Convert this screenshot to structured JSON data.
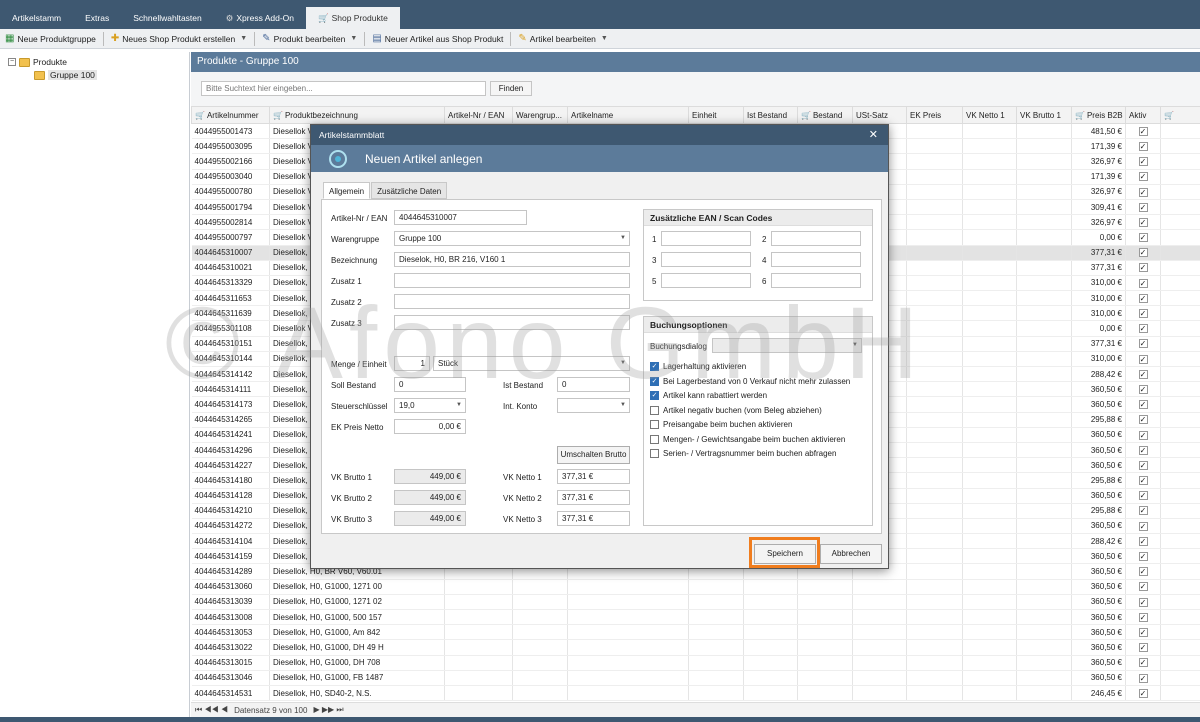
{
  "tabs": [
    "Artikelstamm",
    "Extras",
    "Schnellwahltasten",
    "Xpress Add-On",
    "Shop Produkte"
  ],
  "toolbar": {
    "b1": "Neue Produktgruppe",
    "b2": "Neues Shop Produkt erstellen",
    "b3": "Produkt bearbeiten",
    "b4": "Neuer Artikel aus Shop Produkt",
    "b5": "Artikel bearbeiten"
  },
  "tree": {
    "root": "Produkte",
    "child": "Gruppe 100",
    "expander": "−"
  },
  "panel": {
    "title": "Produkte - Gruppe 100",
    "search_placeholder": "Bitte Suchtext hier eingeben...",
    "find": "Finden"
  },
  "grid": {
    "columns": [
      "Artikelnummer",
      "Produktbezeichnung",
      "Artikel-Nr / EAN",
      "Warengrup...",
      "Artikelname",
      "Einheit",
      "Ist Bestand",
      "Bestand",
      "USt-Satz",
      "EK Preis",
      "VK Netto 1",
      "VK Brutto 1",
      "Preis B2B",
      "Aktiv"
    ],
    "rows": [
      [
        "4044955001473",
        "Diesellok V",
        "481,50 €"
      ],
      [
        "4044955003095",
        "Diesellok V",
        "171,39 €"
      ],
      [
        "4044955002166",
        "Diesellok V",
        "326,97 €"
      ],
      [
        "4044955003040",
        "Diesellok V",
        "171,39 €"
      ],
      [
        "4044955000780",
        "Diesellok V",
        "326,97 €"
      ],
      [
        "4044955001794",
        "Diesellok V",
        "309,41 €"
      ],
      [
        "4044955002814",
        "Diesellok V",
        "326,97 €"
      ],
      [
        "4044955000797",
        "Diesellok V",
        "0,00 €"
      ],
      [
        "4044645310007",
        "Diesellok, H",
        "377,31 €"
      ],
      [
        "4044645310021",
        "Diesellok, H",
        "377,31 €"
      ],
      [
        "4044645313329",
        "Diesellok, H",
        "310,00 €"
      ],
      [
        "4044645311653",
        "Diesellok, H",
        "310,00 €"
      ],
      [
        "4044645311639",
        "Diesellok, H",
        "310,00 €"
      ],
      [
        "4044955301108",
        "Diesellok V",
        "0,00 €"
      ],
      [
        "4044645310151",
        "Diesellok, H",
        "377,31 €"
      ],
      [
        "4044645310144",
        "Diesellok, H",
        "310,00 €"
      ],
      [
        "4044645314142",
        "Diesellok, H",
        "288,42 €"
      ],
      [
        "4044645314111",
        "Diesellok, H",
        "360,50 €"
      ],
      [
        "4044645314173",
        "Diesellok, H",
        "360,50 €"
      ],
      [
        "4044645314265",
        "Diesellok, H",
        "295,88 €"
      ],
      [
        "4044645314241",
        "Diesellok, H",
        "360,50 €"
      ],
      [
        "4044645314296",
        "Diesellok, H",
        "360,50 €"
      ],
      [
        "4044645314227",
        "Diesellok, H",
        "360,50 €"
      ],
      [
        "4044645314180",
        "Diesellok, H",
        "295,88 €"
      ],
      [
        "4044645314128",
        "Diesellok, H",
        "360,50 €"
      ],
      [
        "4044645314210",
        "Diesellok, H",
        "295,88 €"
      ],
      [
        "4044645314272",
        "Diesellok, H",
        "360,50 €"
      ],
      [
        "4044645314104",
        "Diesellok, H",
        "288,42 €"
      ],
      [
        "4044645314159",
        "Diesellok, H",
        "360,50 €"
      ],
      [
        "4044645314289",
        "Diesellok, H0, BR V60, V60.01",
        "360,50 €"
      ],
      [
        "4044645313060",
        "Diesellok, H0, G1000, 1271 00",
        "360,50 €"
      ],
      [
        "4044645313039",
        "Diesellok, H0, G1000, 1271 02",
        "360,50 €"
      ],
      [
        "4044645313008",
        "Diesellok, H0, G1000, 500 157",
        "360,50 €"
      ],
      [
        "4044645313053",
        "Diesellok, H0, G1000, Am 842",
        "360,50 €"
      ],
      [
        "4044645313022",
        "Diesellok, H0, G1000, DH 49 H",
        "360,50 €"
      ],
      [
        "4044645313015",
        "Diesellok, H0, G1000, DH 708",
        "360,50 €"
      ],
      [
        "4044645313046",
        "Diesellok, H0, G1000, FB 1487",
        "360,50 €"
      ],
      [
        "4044645314531",
        "Diesellok, H0, SD40-2, N.S.",
        "246,45 €"
      ]
    ],
    "check": "✓",
    "nav_text": "Datensatz 9 von 100",
    "nav_left": "⏮ ◀◀ ◀",
    "nav_right": "▶ ▶▶ ⏭"
  },
  "dialog": {
    "title": "Artikelstammblatt",
    "close": "✕",
    "header": "Neuen Artikel anlegen",
    "tabs": [
      "Allgemein",
      "Zusätzliche Daten"
    ],
    "labels": {
      "ean": "Artikel-Nr / EAN",
      "wg": "Warengruppe",
      "bez": "Bezeichnung",
      "z1": "Zusatz 1",
      "z2": "Zusatz 2",
      "z3": "Zusatz 3",
      "menge": "Menge / Einheit",
      "soll": "Soll Bestand",
      "ist": "Ist Bestand",
      "steuer": "Steuerschlüssel",
      "konto": "Int. Konto",
      "ek": "EK Preis Netto",
      "vkb1": "VK Brutto 1",
      "vkb2": "VK Brutto 2",
      "vkb3": "VK Brutto 3",
      "vkn1": "VK Netto 1",
      "vkn2": "VK Netto 2",
      "vkn3": "VK Netto 3"
    },
    "values": {
      "ean": "4044645310007",
      "wg": "Gruppe 100",
      "bez": "Dieselok, H0, BR 216, V160 1",
      "menge": "1",
      "einheit": "Stück",
      "soll": "0",
      "ist": "0",
      "steuer": "19,0",
      "ek": "0,00 €",
      "vkb1": "449,00 €",
      "vkb2": "449,00 €",
      "vkb3": "449,00 €",
      "vkn1": "377,31 €",
      "vkn2": "377,31 €",
      "vkn3": "377,31 €"
    },
    "umschalten": "Umschalten Brutto",
    "ean_group": {
      "title": "Zusätzliche EAN / Scan Codes",
      "nums": [
        "1",
        "2",
        "3",
        "4",
        "5",
        "6"
      ]
    },
    "buchung": {
      "title": "Buchungsoptionen",
      "dialog_label": "Buchungsdialog",
      "options": [
        {
          "label": "Lagerhaltung aktivieren",
          "checked": true
        },
        {
          "label": "Bei Lagerbestand von 0 Verkauf nicht mehr zulassen",
          "checked": true
        },
        {
          "label": "Artikel kann rabattiert werden",
          "checked": true
        },
        {
          "label": "Artikel negativ buchen (vom Beleg abziehen)",
          "checked": false
        },
        {
          "label": "Preisangabe beim buchen aktivieren",
          "checked": false
        },
        {
          "label": "Mengen- / Gewichtsangabe beim buchen aktivieren",
          "checked": false
        },
        {
          "label": "Serien- / Vertragsnummer beim buchen abfragen",
          "checked": false
        }
      ]
    },
    "save": "Speichern",
    "cancel": "Abbrechen"
  },
  "watermark": "© Afono GmbH",
  "colors": {
    "header": "#3e5871",
    "panel_title": "#5c7b9a",
    "highlight": "#f07d1e",
    "check": "#2f6fb5"
  }
}
